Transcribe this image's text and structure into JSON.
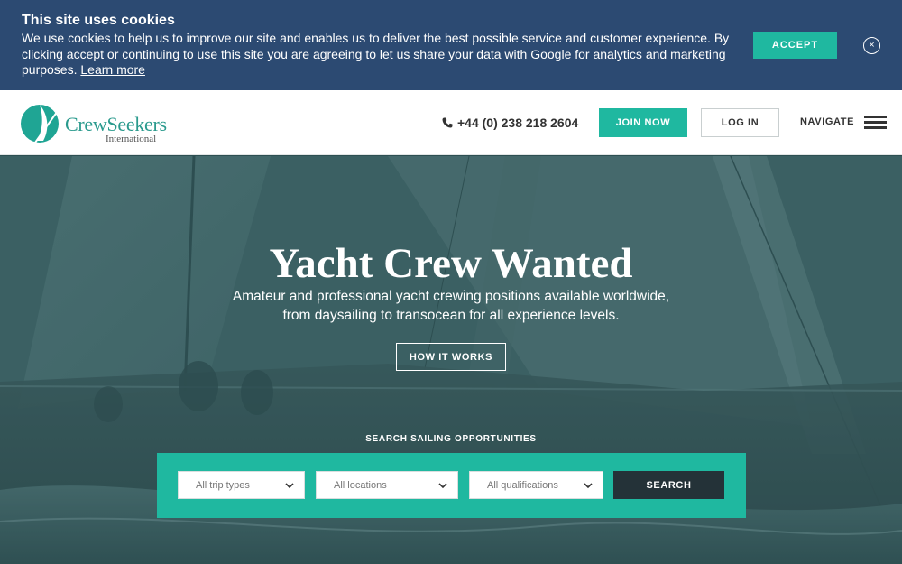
{
  "cookie_banner": {
    "title": "This site uses cookies",
    "text": "We use cookies to help us to improve our site and enables us to deliver the best possible service and customer experience. By clicking accept or continuing to use this site you are agreeing to let us share your data with Google for analytics and marketing purposes. ",
    "learn_more": "Learn more",
    "accept_label": "ACCEPT",
    "close_symbol": "×"
  },
  "header": {
    "logo_name": "CrewSeekers",
    "logo_sub": "International",
    "phone": "+44 (0) 238 218 2604",
    "join_label": "JOIN NOW",
    "login_label": "LOG IN",
    "navigate_label": "NAVIGATE"
  },
  "hero": {
    "title": "Yacht Crew Wanted",
    "subtitle": "Amateur and professional yacht crewing positions available worldwide, from daysailing to transocean for all experience levels.",
    "how_label": "HOW IT WORKS"
  },
  "search": {
    "label": "SEARCH SAILING OPPORTUNITIES",
    "trip_types": "All trip types",
    "locations": "All locations",
    "qualifications": "All qualifications",
    "button_label": "SEARCH"
  },
  "colors": {
    "banner": "#2c4a72",
    "accent": "#1fb8a0",
    "dark_button": "#243238",
    "hero_overlay": "#3e6466"
  },
  "icons": [
    "phone-icon",
    "close-icon",
    "hamburger-icon",
    "chevron-down-icon",
    "sail-logo-icon"
  ]
}
